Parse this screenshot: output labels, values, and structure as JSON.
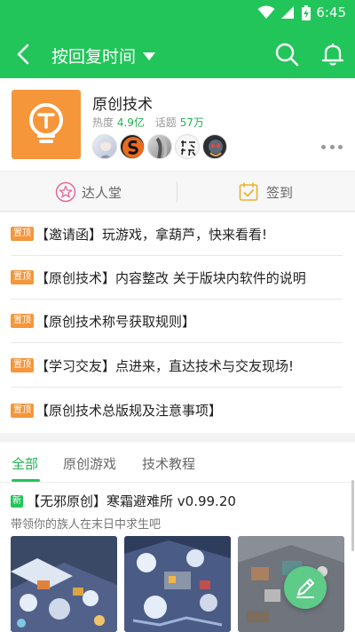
{
  "status_bar": {
    "time": "6:45"
  },
  "navbar": {
    "title": "按回复时间"
  },
  "forum": {
    "name": "原创技术",
    "heat_label": "热度",
    "heat_value": "4.9亿",
    "topics_label": "话题",
    "topics_value": "57万"
  },
  "quick_actions": [
    {
      "label": "达人堂",
      "icon": "star-badge-icon"
    },
    {
      "label": "签到",
      "icon": "calendar-check-icon"
    }
  ],
  "pinned_posts": [
    {
      "badge": "置顶",
      "title": "【邀请函】玩游戏，拿葫芦，快来看看!"
    },
    {
      "badge": "置顶",
      "title": "【原创技术】内容整改 关于版块内软件的说明"
    },
    {
      "badge": "置顶",
      "title": "【原创技术称号获取规则】"
    },
    {
      "badge": "置顶",
      "title": "【学习交友】点进来，直达技术与交友现场!"
    },
    {
      "badge": "置顶",
      "title": "【原创技术总版规及注意事项】"
    }
  ],
  "tabs": [
    {
      "label": "全部",
      "active": true
    },
    {
      "label": "原创游戏",
      "active": false
    },
    {
      "label": "技术教程",
      "active": false
    }
  ],
  "post": {
    "badge": "新",
    "title": "【无邪原创】寒霜避难所 v0.99.20",
    "desc": "带领你的族人在末日中求生吧"
  },
  "colors": {
    "brand_green": "#22c55a",
    "pin_orange": "#f6963a"
  }
}
